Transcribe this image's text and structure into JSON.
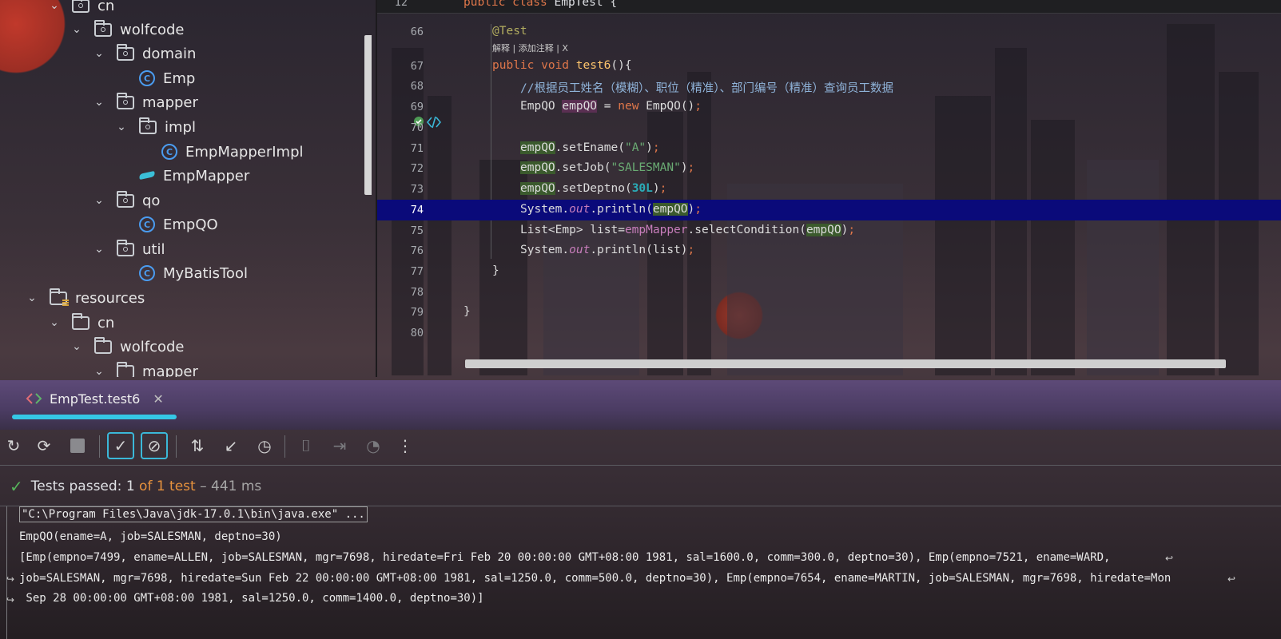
{
  "project_tree": {
    "items": [
      {
        "label": "cn",
        "type": "package",
        "expanded": true
      },
      {
        "label": "wolfcode",
        "type": "package",
        "expanded": true
      },
      {
        "label": "domain",
        "type": "package",
        "expanded": true
      },
      {
        "label": "Emp",
        "type": "class"
      },
      {
        "label": "mapper",
        "type": "package",
        "expanded": true
      },
      {
        "label": "impl",
        "type": "package",
        "expanded": true
      },
      {
        "label": "EmpMapperImpl",
        "type": "class"
      },
      {
        "label": "EmpMapper",
        "type": "mapper-interface"
      },
      {
        "label": "qo",
        "type": "package",
        "expanded": true
      },
      {
        "label": "EmpQO",
        "type": "class"
      },
      {
        "label": "util",
        "type": "package",
        "expanded": true
      },
      {
        "label": "MyBatisTool",
        "type": "class"
      },
      {
        "label": "resources",
        "type": "resources-root",
        "expanded": true
      },
      {
        "label": "cn",
        "type": "folder",
        "expanded": true
      },
      {
        "label": "wolfcode",
        "type": "folder",
        "expanded": true
      },
      {
        "label": "mapper",
        "type": "folder",
        "expanded": true
      }
    ]
  },
  "editor": {
    "sticky_line_number": "12",
    "sticky_code": "public class EmpTest {",
    "inlay_hint": "解释 | 添加注释 | X",
    "lines": [
      {
        "num": "66",
        "code": "@Test"
      },
      {
        "num": "67",
        "code": "public void test6(){"
      },
      {
        "num": "68",
        "code": "//根据员工姓名（模糊）、职位（精准）、部门编号（精准）查询员工数据"
      },
      {
        "num": "69",
        "code": "EmpQO empQO = new EmpQO();"
      },
      {
        "num": "70",
        "code": ""
      },
      {
        "num": "71",
        "code": "empQO.setEname(\"A\");"
      },
      {
        "num": "72",
        "code": "empQO.setJob(\"SALESMAN\");"
      },
      {
        "num": "73",
        "code": "empQO.setDeptno(30L);"
      },
      {
        "num": "74",
        "code": "System.out.println(empQO);"
      },
      {
        "num": "75",
        "code": "List<Emp> list=empMapper.selectCondition(empQO);"
      },
      {
        "num": "76",
        "code": "System.out.println(list);"
      },
      {
        "num": "77",
        "code": "}"
      },
      {
        "num": "78",
        "code": ""
      },
      {
        "num": "79",
        "code": "}"
      },
      {
        "num": "80",
        "code": ""
      }
    ],
    "current_line": "74"
  },
  "run_panel": {
    "tab_label": "EmpTest.test6",
    "toolbar_icons": [
      "rerun-icon",
      "rerun-failed-icon",
      "stop-icon",
      "show-passed-icon",
      "show-ignored-icon",
      "sort-icon",
      "collapse-icon",
      "history-icon",
      "screenshot-icon",
      "import-icon",
      "coverage-icon",
      "more-icon"
    ],
    "status": {
      "prefix": "Tests passed: ",
      "passed": "1",
      "of_text": " of 1 test",
      "duration": " – 441 ms"
    },
    "console": [
      "\"C:\\Program Files\\Java\\jdk-17.0.1\\bin\\java.exe\" ...",
      "EmpQO(ename=A, job=SALESMAN, deptno=30)",
      "[Emp(empno=7499, ename=ALLEN, job=SALESMAN, mgr=7698, hiredate=Fri Feb 20 00:00:00 GMT+08:00 1981, sal=1600.0, comm=300.0, deptno=30), Emp(empno=7521, ename=WARD,",
      "job=SALESMAN, mgr=7698, hiredate=Sun Feb 22 00:00:00 GMT+08:00 1981, sal=1250.0, comm=500.0, deptno=30), Emp(empno=7654, ename=MARTIN, job=SALESMAN, mgr=7698, hiredate=Mon",
      " Sep 28 00:00:00 GMT+08:00 1981, sal=1250.0, comm=1400.0, deptno=30)]"
    ]
  }
}
